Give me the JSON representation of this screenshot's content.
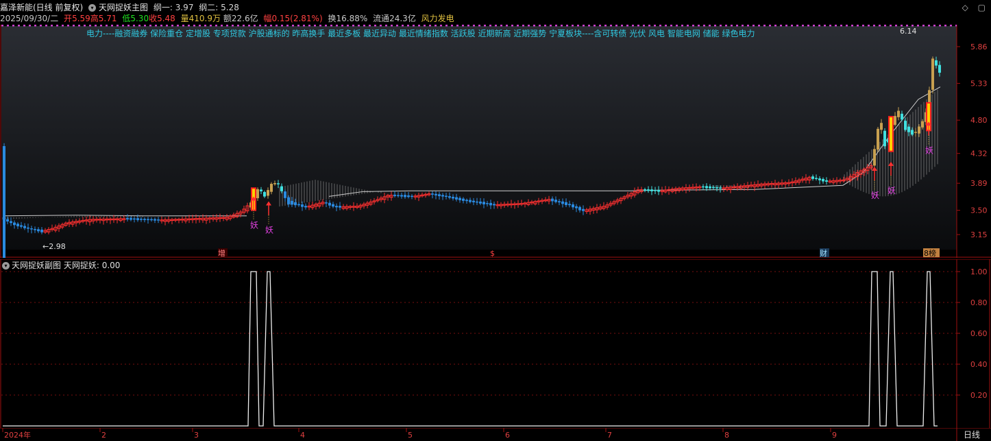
{
  "header": {
    "stock_name": "嘉泽新能(日线 前复权)",
    "indicator_main": "天网捉妖主图",
    "net1_label": "纲一:",
    "net1_value": "3.97",
    "net2_label": "纲二:",
    "net2_value": "5.28"
  },
  "quote": {
    "date": "2025/09/30/二",
    "open_label": "开",
    "open": "5.59",
    "high_label": "高",
    "high": "5.71",
    "low_label": "低",
    "low": "5.30",
    "close_label": "收",
    "close": "5.48",
    "volume_label": "量",
    "volume": "410.9万",
    "amount_label": "额",
    "amount": "22.6亿",
    "change_label": "幅",
    "change": "0.15(2.81%)",
    "turnover_label": "换",
    "turnover": "16.88%",
    "float_label": "流通",
    "float": "24.3亿",
    "sector": "风力发电"
  },
  "concept_line": "电力----融资融券 保险重仓 定增股 专项贷款 沪股通标的 昨高换手 最近多板 最近异动 最近情绪指数 活跃股 近期新高 近期强势 宁夏板块----含可转债 光伏 风电 智能电网 储能 绿色电力",
  "window_controls": {
    "diamond": "◇",
    "square": "▢"
  },
  "main_axis": {
    "ticks": [
      "5.86",
      "5.33",
      "4.80",
      "4.32",
      "3.89",
      "3.50",
      "3.15"
    ],
    "high_marker": "6.14",
    "low_marker": "←2.98"
  },
  "event_tags": {
    "zeng": "增",
    "dollar": "$",
    "cai": "财",
    "bang": "8榜",
    "yao": "妖"
  },
  "sub": {
    "title": "天网捉妖副图",
    "indicator_label": "天网捉妖:",
    "indicator_value": "0.00",
    "ticks": [
      "1.00",
      "0.80",
      "0.60",
      "0.40",
      "0.20"
    ]
  },
  "time_axis": {
    "labels": [
      "2024年",
      "2",
      "3",
      "4",
      "5",
      "6",
      "7",
      "8",
      "9"
    ],
    "period": "日线"
  },
  "colors": {
    "up": "#ff3030",
    "down": "#2a8ae0",
    "cyan": "#40e0e0",
    "gold": "#c8a050",
    "magenta": "#e040e0",
    "axis_red": "#a01010"
  },
  "chart_data": {
    "type": "line",
    "title": "",
    "series": [
      {
        "name": "天网捉妖",
        "x": [
          "2024-03-25",
          "2024-03-27",
          "2024-09-18",
          "2024-09-20",
          "2024-09-25"
        ],
        "values": [
          1,
          1,
          1,
          1,
          1
        ]
      }
    ],
    "ylim": [
      0,
      1.05
    ],
    "price_range": [
      2.98,
      6.14
    ]
  }
}
